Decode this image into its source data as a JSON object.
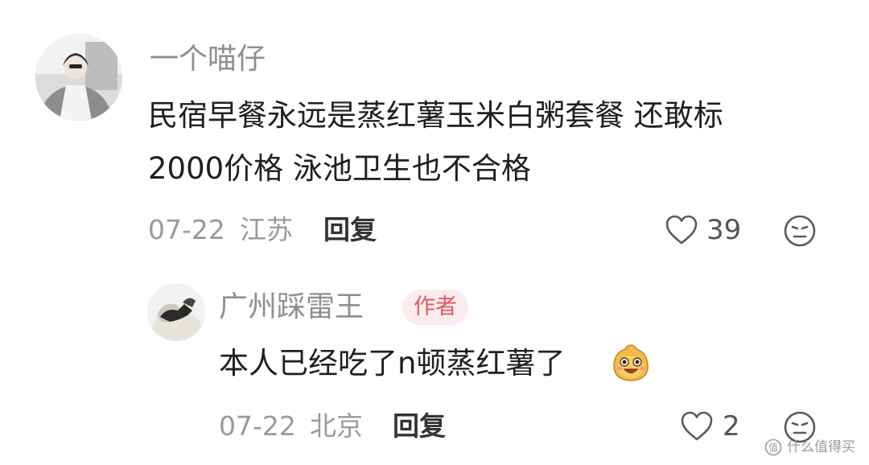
{
  "comments": [
    {
      "username": "一个喵仔",
      "text_lines": [
        "民宿早餐永远是蒸红薯玉米白粥套餐 还敢标",
        "2000价格 泳池卫生也不合格"
      ],
      "date": "07-22",
      "location": "江苏",
      "reply_label": "回复",
      "like_count": "39",
      "avatar_icon": "user-avatar-photo",
      "like_icon": "heart-outline-icon",
      "dislike_icon": "meh-face-icon"
    },
    {
      "username": "广州踩雷王",
      "badge": "作者",
      "text": "本人已经吃了n顿蒸红薯了",
      "emoji_icon": "grinning-potato-emoji",
      "date": "07-22",
      "location": "北京",
      "reply_label": "回复",
      "like_count": "2",
      "avatar_icon": "user-avatar-photo",
      "like_icon": "heart-outline-icon",
      "dislike_icon": "meh-face-icon"
    }
  ],
  "watermark": {
    "text": "什么值得买",
    "icon": "smzdm-logo-icon"
  },
  "colors": {
    "username": "#8f8f8f",
    "meta": "#9a9a9a",
    "badge_bg": "#fdecee",
    "badge_text": "#e05a68"
  }
}
